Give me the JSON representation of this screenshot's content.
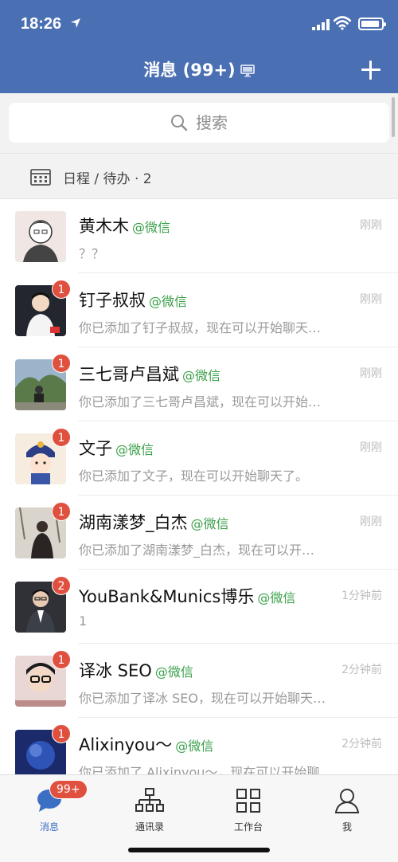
{
  "status_bar": {
    "time": "18:26"
  },
  "header": {
    "title": "消息 (99+)"
  },
  "search": {
    "placeholder": "搜索"
  },
  "schedule": {
    "label": "日程 / 待办 · 2"
  },
  "conversations": [
    {
      "name": "黄木木",
      "tag": "@微信",
      "time": "刚刚",
      "message": "？？",
      "badge": ""
    },
    {
      "name": "钉子叔叔",
      "tag": "@微信",
      "time": "刚刚",
      "message": "你已添加了钉子叔叔，现在可以开始聊天…",
      "badge": "1"
    },
    {
      "name": "三七哥卢昌斌",
      "tag": "@微信",
      "time": "刚刚",
      "message": "你已添加了三七哥卢昌斌，现在可以开始…",
      "badge": "1"
    },
    {
      "name": "文子",
      "tag": "@微信",
      "time": "刚刚",
      "message": "你已添加了文子，现在可以开始聊天了。",
      "badge": "1"
    },
    {
      "name": "湖南漾梦_白杰",
      "tag": "@微信",
      "time": "刚刚",
      "message": "你已添加了湖南漾梦_白杰，现在可以开…",
      "badge": "1"
    },
    {
      "name": "YouBank&Munics博乐",
      "tag": "@微信",
      "time": "1分钟前",
      "message": "1",
      "badge": "2"
    },
    {
      "name": "译冰 SEO",
      "tag": "@微信",
      "time": "2分钟前",
      "message": "你已添加了译冰 SEO，现在可以开始聊天…",
      "badge": "1"
    },
    {
      "name": "Alixinyou～",
      "tag": "@微信",
      "time": "2分钟前",
      "message": "你已添加了 Alixinyou～，现在可以开始聊",
      "badge": "1"
    }
  ],
  "tabbar": {
    "tabs": [
      {
        "label": "消息",
        "badge": "99+",
        "icon": "chat-bubble-icon"
      },
      {
        "label": "通讯录",
        "icon": "org-chart-icon"
      },
      {
        "label": "工作台",
        "icon": "grid-icon"
      },
      {
        "label": "我",
        "icon": "person-icon"
      }
    ]
  },
  "colors": {
    "header_bg": "#4a6fb3",
    "badge": "#e0503f",
    "tag": "#3aa04a",
    "active_tab": "#3b6fc4"
  }
}
